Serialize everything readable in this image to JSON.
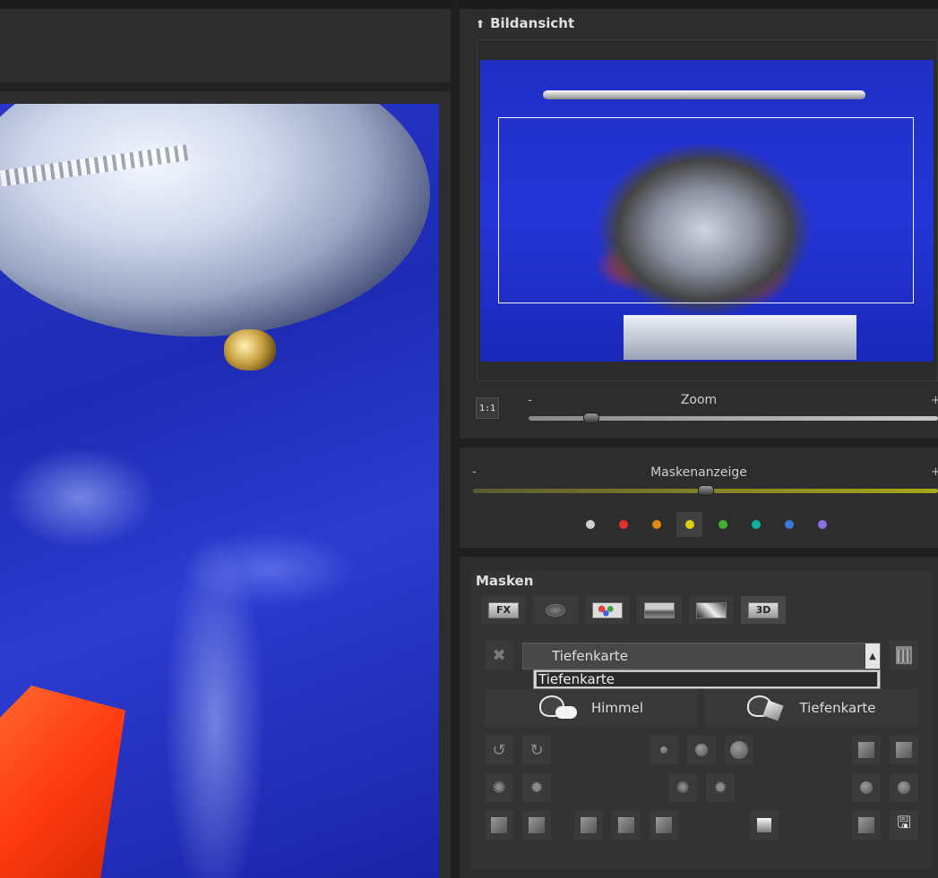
{
  "panels": {
    "bildansicht": {
      "title": "Bildansicht",
      "zoom_label": "Zoom",
      "zoom_minus": "-",
      "zoom_plus": "+",
      "one_to_one": "1:1",
      "zoom_level": 0.14
    },
    "maskenanzeige": {
      "label": "Maskenanzeige",
      "minus": "-",
      "plus": "+",
      "level": 0.5,
      "colors": [
        "#d0d0d0",
        "#e03030",
        "#e08a10",
        "#e0d010",
        "#40b030",
        "#10b0a0",
        "#3a7ae0",
        "#8a70e0"
      ],
      "active_color_index": 3
    },
    "masken": {
      "title": "Masken",
      "tabs": [
        "FX",
        "",
        "",
        "",
        "",
        "3D"
      ],
      "active_tab_index": 5,
      "select_value": "Tiefenkarte",
      "dropdown_item": "Tiefenkarte",
      "presets": [
        "Himmel",
        "Tiefenkarte"
      ]
    }
  }
}
